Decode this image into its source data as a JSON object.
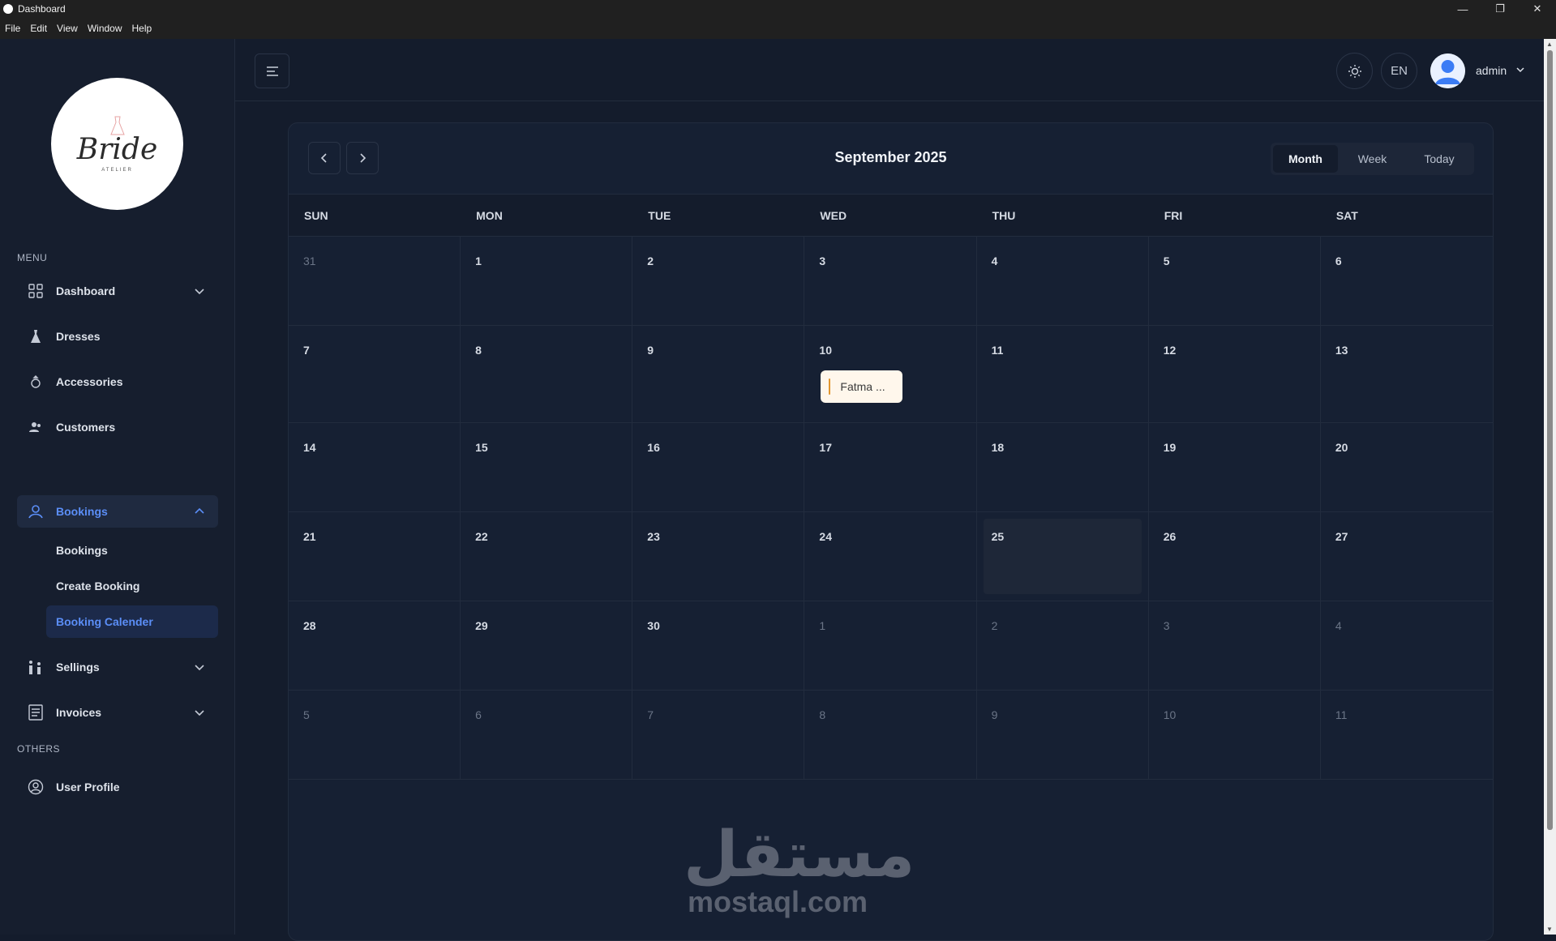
{
  "window": {
    "title": "Dashboard",
    "menu": [
      "File",
      "Edit",
      "View",
      "Window",
      "Help"
    ]
  },
  "sidebar": {
    "logo_text": "Bride",
    "logo_sub": "ATELIER",
    "menu_label": "MENU",
    "others_label": "OTHERS",
    "items": {
      "dashboard": "Dashboard",
      "dresses": "Dresses",
      "accessories": "Accessories",
      "customers": "Customers",
      "bookings": "Bookings",
      "sellings": "Sellings",
      "invoices": "Invoices",
      "user_profile": "User Profile"
    },
    "bookings_sub": {
      "bookings": "Bookings",
      "create": "Create Booking",
      "calendar": "Booking Calender"
    }
  },
  "header": {
    "lang": "EN",
    "user": "admin"
  },
  "calendar": {
    "title": "September 2025",
    "views": {
      "month": "Month",
      "week": "Week",
      "today": "Today"
    },
    "weekdays": [
      "SUN",
      "MON",
      "TUE",
      "WED",
      "THU",
      "FRI",
      "SAT"
    ],
    "weeks": [
      [
        {
          "d": "31",
          "other": true
        },
        {
          "d": "1"
        },
        {
          "d": "2"
        },
        {
          "d": "3"
        },
        {
          "d": "4"
        },
        {
          "d": "5"
        },
        {
          "d": "6"
        }
      ],
      [
        {
          "d": "7"
        },
        {
          "d": "8"
        },
        {
          "d": "9"
        },
        {
          "d": "10",
          "event": "Fatma ..."
        },
        {
          "d": "11"
        },
        {
          "d": "12"
        },
        {
          "d": "13"
        }
      ],
      [
        {
          "d": "14"
        },
        {
          "d": "15"
        },
        {
          "d": "16"
        },
        {
          "d": "17"
        },
        {
          "d": "18"
        },
        {
          "d": "19"
        },
        {
          "d": "20"
        }
      ],
      [
        {
          "d": "21"
        },
        {
          "d": "22"
        },
        {
          "d": "23"
        },
        {
          "d": "24"
        },
        {
          "d": "25",
          "today": true
        },
        {
          "d": "26"
        },
        {
          "d": "27"
        }
      ],
      [
        {
          "d": "28"
        },
        {
          "d": "29"
        },
        {
          "d": "30"
        },
        {
          "d": "1",
          "other": true
        },
        {
          "d": "2",
          "other": true
        },
        {
          "d": "3",
          "other": true
        },
        {
          "d": "4",
          "other": true
        }
      ],
      [
        {
          "d": "5",
          "other": true
        },
        {
          "d": "6",
          "other": true
        },
        {
          "d": "7",
          "other": true
        },
        {
          "d": "8",
          "other": true
        },
        {
          "d": "9",
          "other": true
        },
        {
          "d": "10",
          "other": true
        },
        {
          "d": "11",
          "other": true
        }
      ]
    ]
  },
  "watermark": {
    "arabic": "مستقل",
    "latin": "mostaql.com"
  },
  "colors": {
    "accent": "#5b8ef7",
    "event_bg": "#fff7ec",
    "event_bar": "#e2962f",
    "bg": "#141c2c"
  }
}
